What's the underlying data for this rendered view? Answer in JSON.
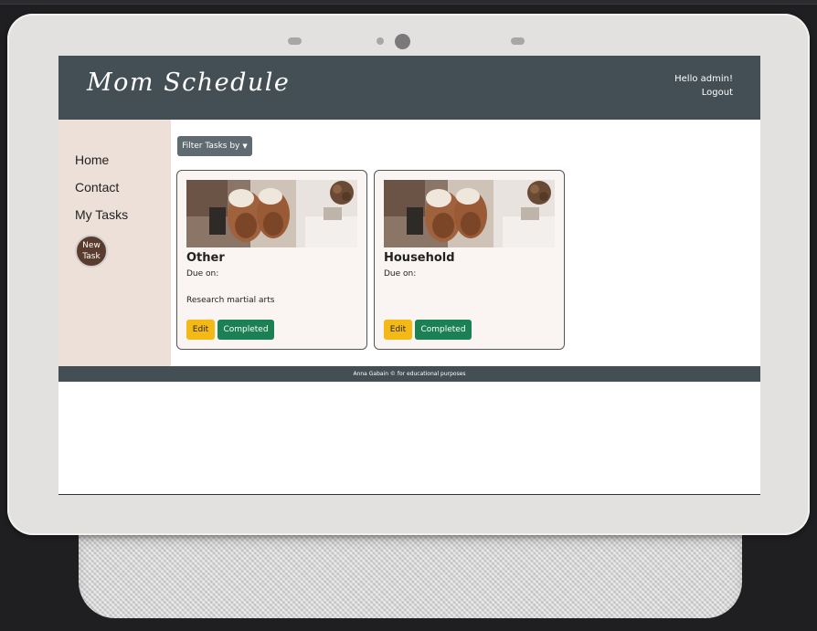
{
  "app": {
    "brand": "Mom Schedule",
    "greeting": "Hello admin!",
    "logout": "Logout"
  },
  "sidebar": {
    "items": [
      {
        "label": "Home"
      },
      {
        "label": "Contact"
      },
      {
        "label": "My Tasks"
      }
    ],
    "new_task": {
      "line1": "New",
      "line2": "Task"
    }
  },
  "filter": {
    "label": "Filter Tasks by"
  },
  "tasks": [
    {
      "category": "Other",
      "due_label": "Due on:",
      "description": "Research martial arts",
      "edit_label": "Edit",
      "completed_label": "Completed",
      "image": "baby-shoes-photo"
    },
    {
      "category": "Household",
      "due_label": "Due on:",
      "description": "",
      "edit_label": "Edit",
      "completed_label": "Completed",
      "image": "baby-shoes-photo"
    }
  ],
  "footer": {
    "text": "Anna Gabain © for educational purposes"
  },
  "colors": {
    "header_bg": "#444f55",
    "sidebar_bg": "#ece0d9",
    "edit_button": "#f4b914",
    "completed_button": "#1b8054",
    "new_task_button": "#5a3c2f",
    "filter_button": "#5f6a71"
  }
}
